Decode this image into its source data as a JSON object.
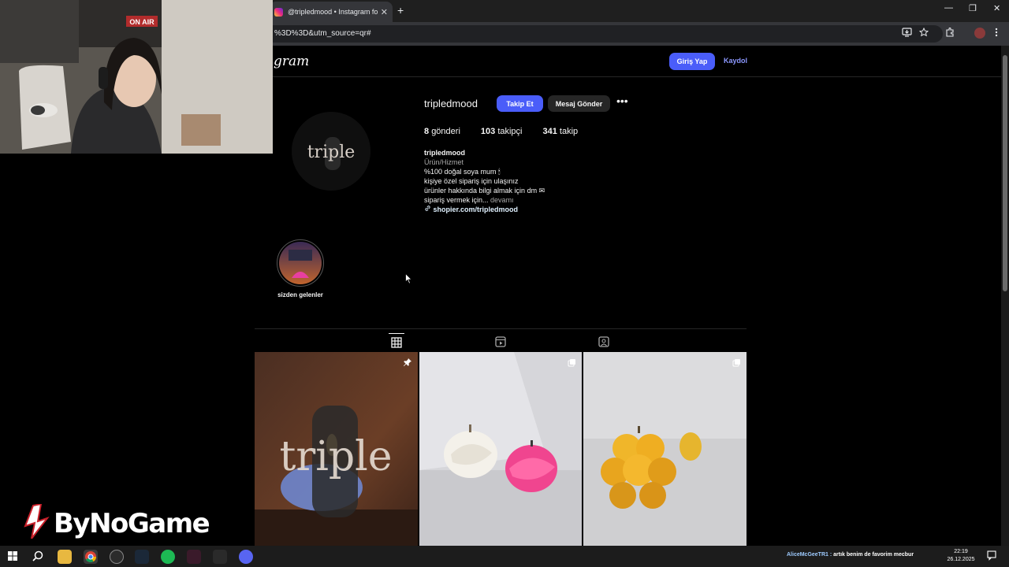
{
  "browser": {
    "tab_title": "@tripledmood • Instagram foto",
    "tab_close": "✕",
    "new_tab": "+",
    "url": "%3D%3D&utm_source=qr#",
    "window_controls": [
      "—",
      "❐",
      "✕"
    ]
  },
  "instagram": {
    "logo": "tagram",
    "login_label": "Giriş Yap",
    "signup_label": "Kaydol"
  },
  "profile": {
    "username": "tripledmood",
    "avatar_text": "triple",
    "follow_label": "Takip Et",
    "message_label": "Mesaj Gönder",
    "more_label": "•••",
    "posts_count": "8",
    "posts_label": "gönderi",
    "followers_count": "103",
    "followers_label": "takipçi",
    "following_count": "341",
    "following_label": "takip",
    "bio_name": "tripledmood",
    "bio_category": "Ürün/Hizmet",
    "bio_line1": "%100 doğal soya mum 🕯",
    "bio_line2": "kişiye özel sipariş için ulaşınız",
    "bio_line3": "ürünler hakkında bilgi almak için dm ✉",
    "bio_line4": "sipariş vermek için...",
    "bio_more": "devamı",
    "bio_link": "shopier.com/tripledmood"
  },
  "highlight": {
    "label": "sizden gelenler"
  },
  "profile_tabs": [
    "posts-grid-icon",
    "reels-icon",
    "tagged-icon"
  ],
  "posts": [
    {
      "overlay_text": "triple",
      "icon": "pin-icon"
    },
    {
      "icon": "carousel-icon"
    },
    {
      "icon": "carousel-icon"
    }
  ],
  "stream": {
    "watermark": "ByNoGame",
    "onair_sign": "ON AIR"
  },
  "taskbar": {
    "marquee_nick": "AliceMcGeeTR1 :",
    "marquee_text": "artık benim de favorim mecbur",
    "time": "22:19",
    "date": "26.12.2025"
  }
}
